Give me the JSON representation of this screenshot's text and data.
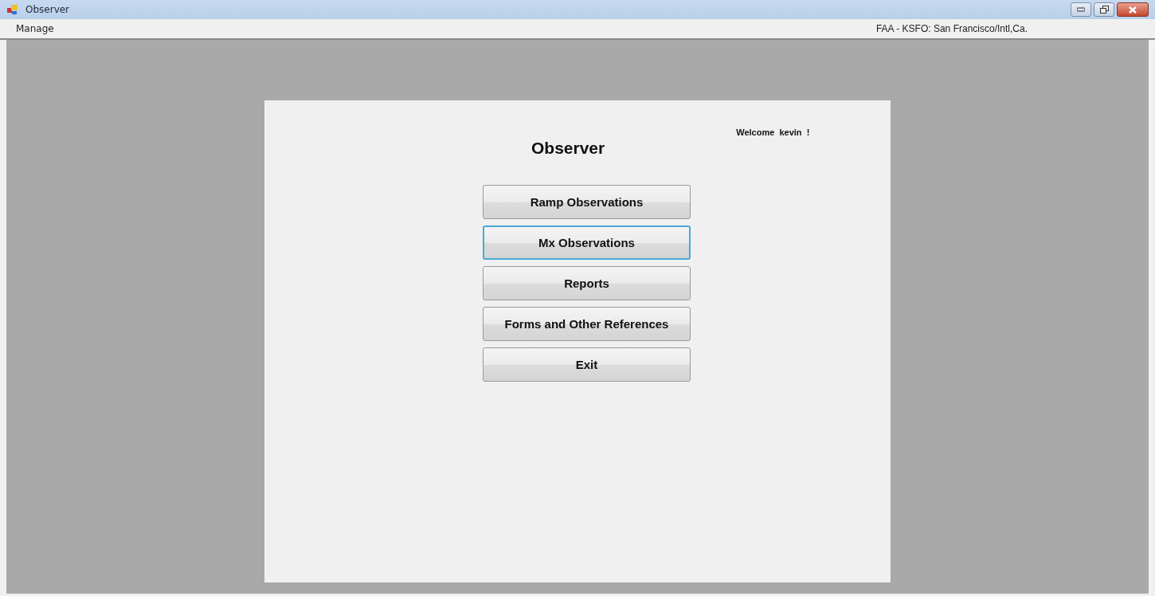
{
  "window": {
    "title": "Observer"
  },
  "menu": [
    {
      "label": "Manage"
    }
  ],
  "location": "FAA - KSFO: San Francisco/Intl,Ca.",
  "panel": {
    "welcome": "Welcome  kevin  !",
    "heading": "Observer",
    "buttons": [
      {
        "label": "Ramp Observations",
        "focused": false
      },
      {
        "label": "Mx Observations",
        "focused": true
      },
      {
        "label": "Reports",
        "focused": false
      },
      {
        "label": "Forms and Other References",
        "focused": false
      },
      {
        "label": "Exit",
        "focused": false
      }
    ]
  }
}
